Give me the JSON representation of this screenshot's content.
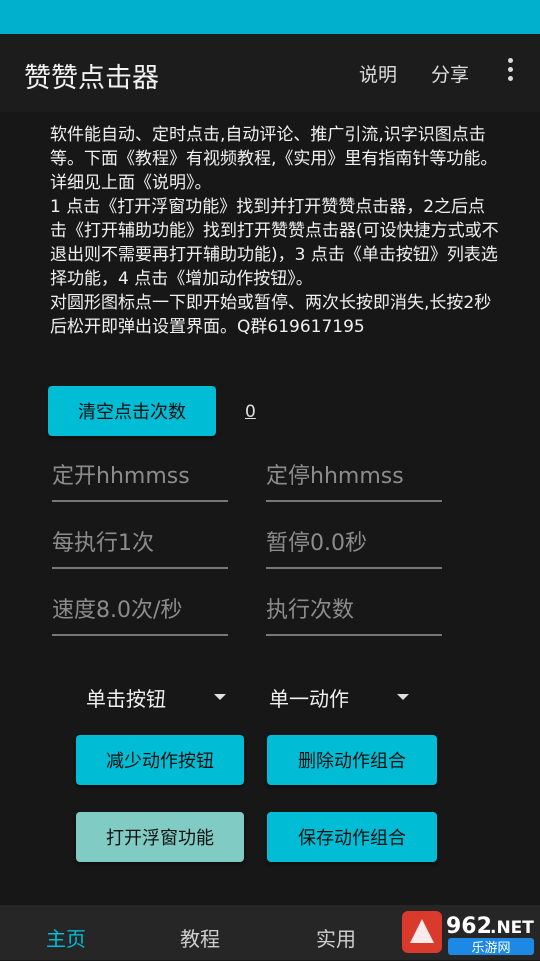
{
  "app": {
    "title": "赞赞点击器",
    "menu": {
      "help": "说明",
      "share": "分享"
    }
  },
  "intro_text": "软件能自动、定时点击,自动评论、推广引流,识字识图点击等。下面《教程》有视频教程,《实用》里有指南针等功能。详细见上面《说明》。\n 1 点击《打开浮窗功能》找到并打开赞赞点击器，2之后点击《打开辅助功能》找到打开赞赞点击器(可设快捷方式或不退出则不需要再打开辅助功能)，3 点击《单击按钮》列表选择功能，4 点击《增加动作按钮》。\n 对圆形图标点一下即开始或暂停、两次长按即消失,长按2秒后松开即弹出设置界面。Q群619617195",
  "clear_button": "清空点击次数",
  "click_count": "0",
  "fields": {
    "timer_start": "定开hhmmss",
    "timer_stop": "定停hhmmss",
    "every_exec": "每执行1次",
    "pause": "暂停0.0秒",
    "speed": "速度8.0次/秒",
    "exec_count": "执行次数"
  },
  "selects": {
    "button_type": "单击按钮",
    "action_type": "单一动作"
  },
  "actions": {
    "reduce": "减少动作按钮",
    "delete_combo": "删除动作组合",
    "open_float": "打开浮窗功能",
    "save_combo": "保存动作组合"
  },
  "bottom_nav": [
    "主页",
    "教程",
    "实用"
  ],
  "watermark": {
    "number": "962",
    "tld": ".NET",
    "site": "乐游网"
  },
  "colors": {
    "accent": "#00bcd4",
    "status_bar": "#00b0cc",
    "disabled_button": "#80cbc4",
    "background": "#171717"
  }
}
